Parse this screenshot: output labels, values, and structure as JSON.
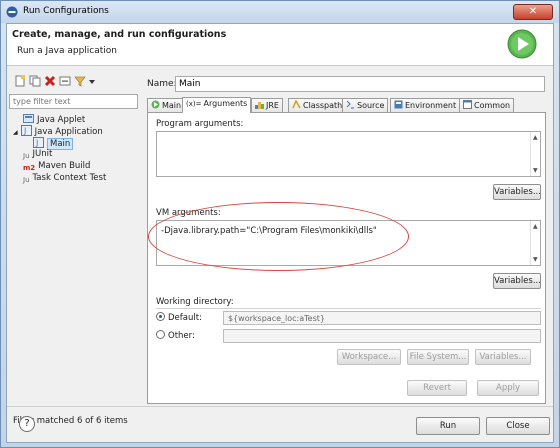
{
  "window": {
    "title": "Run Configurations",
    "close_label": "✕"
  },
  "header": {
    "title": "Create, manage, and run configurations",
    "subtitle": "Run a Java application"
  },
  "left": {
    "filter_placeholder": "type filter text",
    "tree": [
      {
        "label": "Java Applet",
        "icon": "applet-icon",
        "color": "#5a7fb4"
      },
      {
        "label": "Java Application",
        "icon": "java-app-icon",
        "color": "#4c79b8"
      },
      {
        "label": "Main",
        "icon": "java-app-icon",
        "color": "#4c79b8"
      },
      {
        "label": "JUnit",
        "icon": "junit-icon",
        "prefix": "Ju",
        "color": "#6a6a6a"
      },
      {
        "label": "Maven Build",
        "icon": "maven-icon",
        "prefix": "m2",
        "color": "#c5241c"
      },
      {
        "label": "Task Context Test",
        "icon": "task-context-icon",
        "prefix": "Ju",
        "color": "#6a6a6a"
      }
    ],
    "status": "Filter matched 6 of 6 items"
  },
  "right": {
    "name_label": "Name:",
    "name_value": "Main",
    "tabs": [
      {
        "label": "Main",
        "icon": "main-tab-icon",
        "prefix": ""
      },
      {
        "label": "Arguments",
        "icon": "arguments-tab-icon",
        "prefix": "(x)=",
        "active": true
      },
      {
        "label": "JRE",
        "icon": "jre-icon",
        "prefix": ""
      },
      {
        "label": "Classpath",
        "icon": "classpath-icon",
        "prefix": ""
      },
      {
        "label": "Source",
        "icon": "source-icon",
        "prefix": ""
      },
      {
        "label": "Environment",
        "icon": "environment-icon",
        "prefix": ""
      },
      {
        "label": "Common",
        "icon": "common-icon",
        "prefix": ""
      }
    ],
    "program_args_label": "Program arguments:",
    "program_args_value": "",
    "variables_label": "Variables...",
    "vm_args_label": "VM arguments:",
    "vm_args_value": "-Djava.library.path=\"C:\\Program Files\\monkiki\\dlls\"",
    "working_dir_label": "Working directory:",
    "default_label": "Default:",
    "default_value": "${workspace_loc:aTest}",
    "other_label": "Other:",
    "other_value": "",
    "workspace_btn": "Workspace...",
    "filesystem_btn": "File System...",
    "variables_btn": "Variables...",
    "revert_btn": "Revert",
    "apply_btn": "Apply"
  },
  "footer": {
    "help": "?",
    "run_btn": "Run",
    "close_btn": "Close"
  },
  "colors": {
    "accent": "#4fa54a",
    "annotation": "#d9463e",
    "selection": "#cde8ff"
  }
}
